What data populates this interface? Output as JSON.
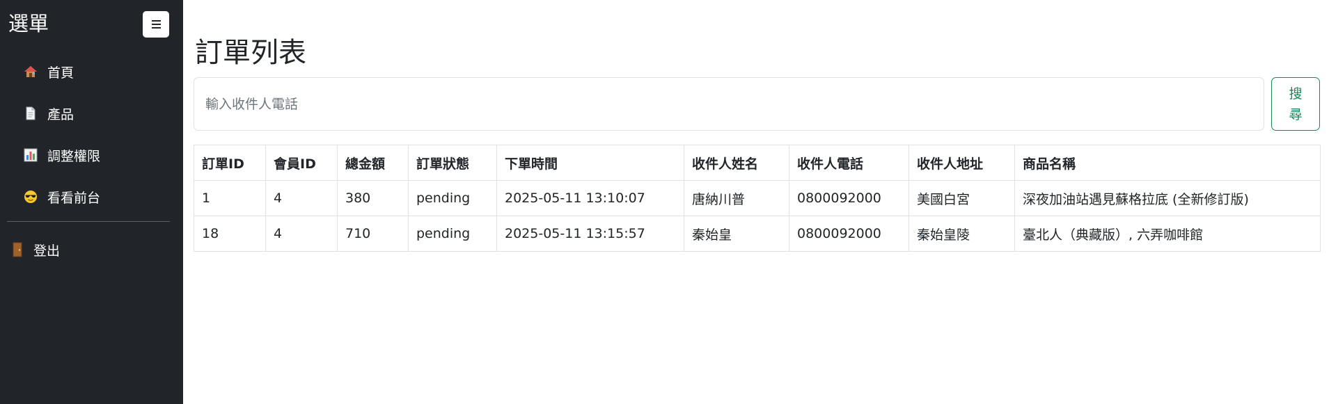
{
  "sidebar": {
    "title": "選單",
    "items": [
      {
        "label": "首頁",
        "icon": "house-icon"
      },
      {
        "label": "產品",
        "icon": "document-icon"
      },
      {
        "label": "調整權限",
        "icon": "bar-chart-icon"
      },
      {
        "label": "看看前台",
        "icon": "sunglasses-face-icon"
      }
    ],
    "logout": {
      "label": "登出",
      "icon": "door-icon"
    }
  },
  "main": {
    "title": "訂單列表",
    "search": {
      "placeholder": "輸入收件人電話",
      "value": "",
      "button_label": "搜尋"
    },
    "table": {
      "headers": [
        "訂單ID",
        "會員ID",
        "總金額",
        "訂單狀態",
        "下單時間",
        "收件人姓名",
        "收件人電話",
        "收件人地址",
        "商品名稱"
      ],
      "rows": [
        [
          "1",
          "4",
          "380",
          "pending",
          "2025-05-11 13:10:07",
          "唐納川普",
          "0800092000",
          "美國白宮",
          "深夜加油站遇見蘇格拉底 (全新修訂版)"
        ],
        [
          "18",
          "4",
          "710",
          "pending",
          "2025-05-11 13:15:57",
          "秦始皇",
          "0800092000",
          "秦始皇陵",
          "臺北人（典藏版）, 六弄咖啡館"
        ]
      ]
    }
  },
  "colors": {
    "sidebar_bg": "#212529",
    "accent_green": "#198754",
    "border": "#dee2e6"
  }
}
